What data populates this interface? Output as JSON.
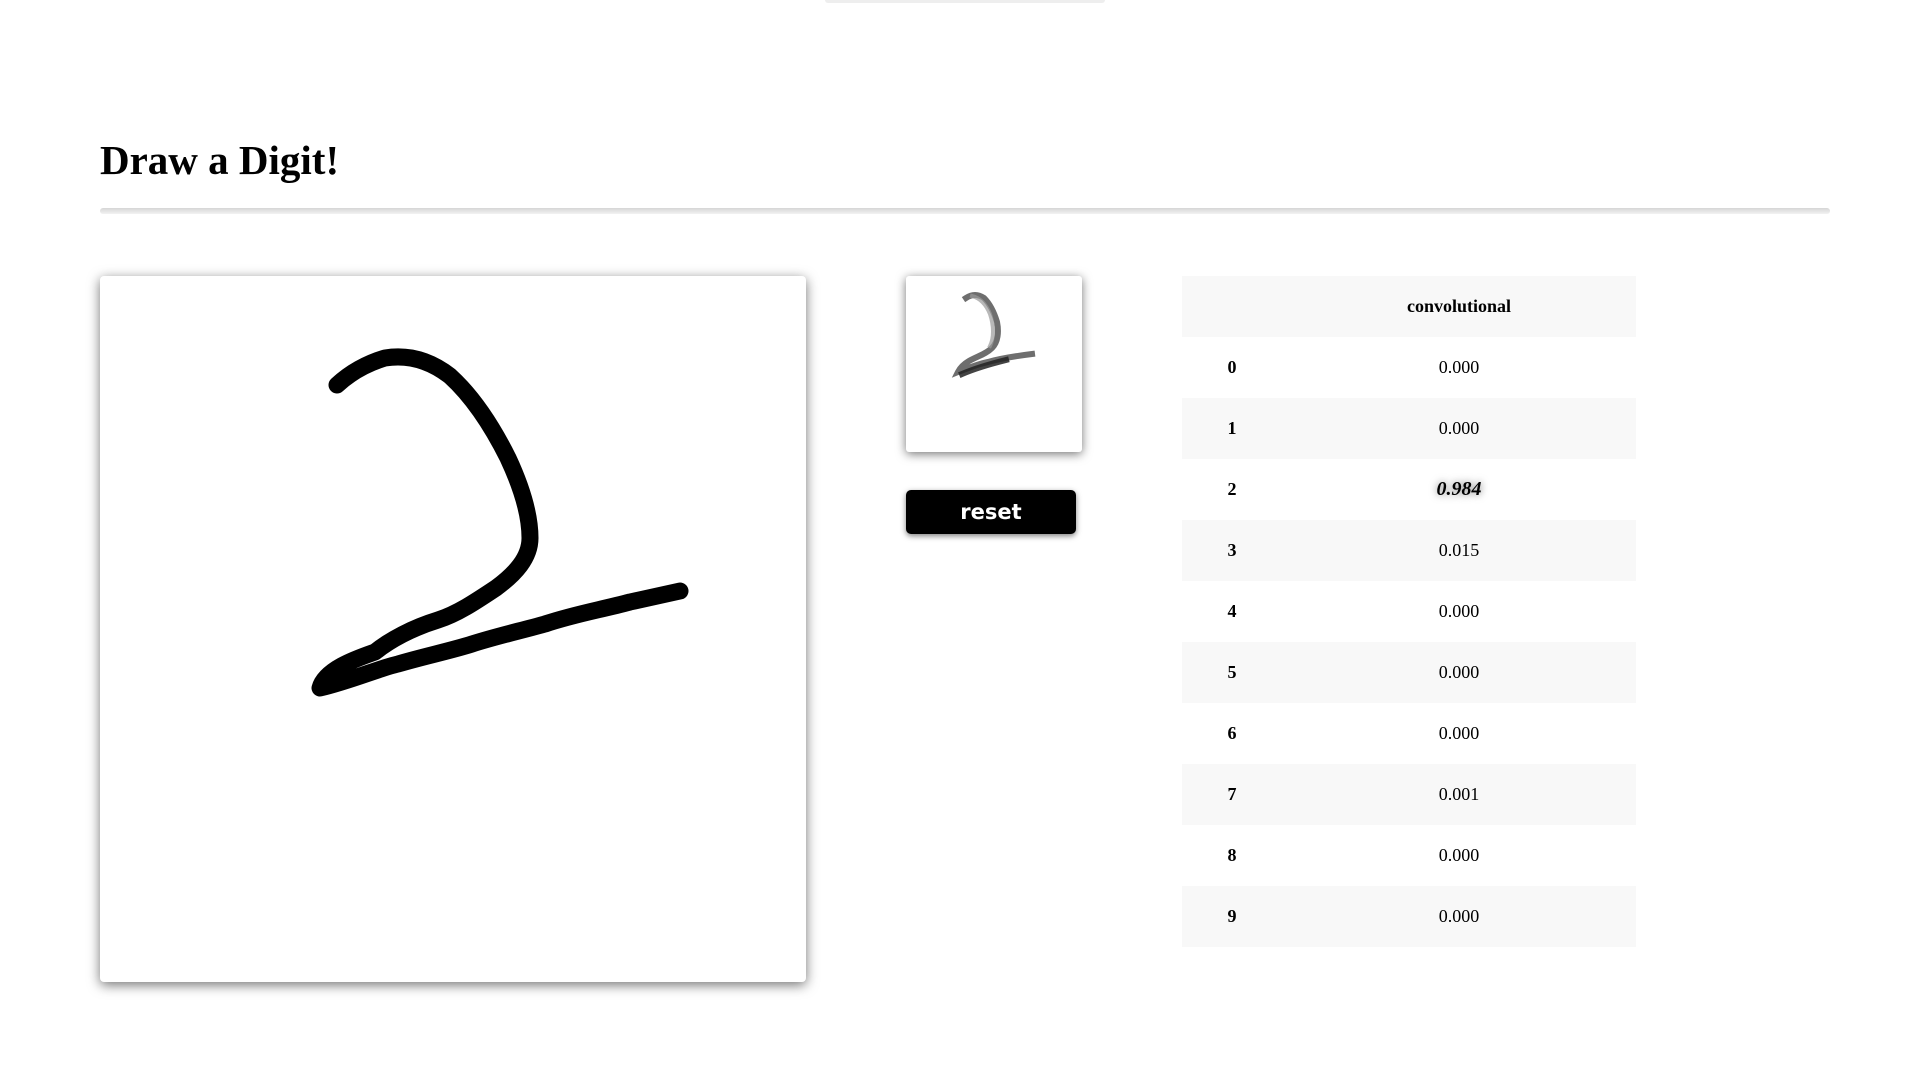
{
  "page": {
    "title": "Draw a Digit!"
  },
  "controls": {
    "reset_label": "reset"
  },
  "results": {
    "column_header": "convolutional",
    "rows": [
      {
        "digit": "0",
        "value": "0.000",
        "best": false
      },
      {
        "digit": "1",
        "value": "0.000",
        "best": false
      },
      {
        "digit": "2",
        "value": "0.984",
        "best": true
      },
      {
        "digit": "3",
        "value": "0.015",
        "best": false
      },
      {
        "digit": "4",
        "value": "0.000",
        "best": false
      },
      {
        "digit": "5",
        "value": "0.000",
        "best": false
      },
      {
        "digit": "6",
        "value": "0.000",
        "best": false
      },
      {
        "digit": "7",
        "value": "0.001",
        "best": false
      },
      {
        "digit": "8",
        "value": "0.000",
        "best": false
      },
      {
        "digit": "9",
        "value": "0.000",
        "best": false
      }
    ]
  },
  "colors": {
    "stroke": "#000000",
    "row_stripe": "#f8f8f8",
    "button_background": "#000000",
    "button_text": "#ffffff"
  }
}
